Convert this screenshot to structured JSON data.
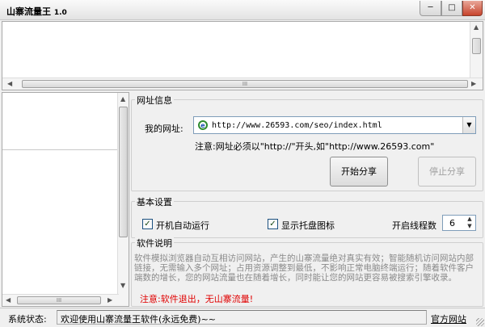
{
  "window": {
    "title": "山寨流量王",
    "version": "1.0",
    "minimize_glyph": "─",
    "maximize_glyph": "□",
    "close_glyph": "✕"
  },
  "browser": {
    "hscroll_grip": "III"
  },
  "left_pane": {
    "hscroll_grip": "III"
  },
  "url_group": {
    "title": "网址信息",
    "label": "我的网址:",
    "url_value": "http://www.26593.com/seo/index.html",
    "note": "注意:网址必须以\"http://\"开头,如\"http://www.26593.com\"",
    "start_button": "开始分享",
    "stop_button": "停止分享"
  },
  "settings_group": {
    "title": "基本设置",
    "autorun_label": "开机自动运行",
    "autorun_checked": true,
    "tray_label": "显示托盘图标",
    "tray_checked": true,
    "threads_label": "开启线程数",
    "threads_value": "6"
  },
  "about_group": {
    "title": "软件说明",
    "description": "软件模拟浏览器自动互相访问网站，产生的山寨流量绝对真实有效；智能随机访问网站内部链接，无需输入多个网址；占用资源调整到最低，不影响正常电脑终端运行；随着软件客户端数的增长，您的网站流量也在随着增长，同时能让您的网站更容易被搜索引擎收录。",
    "warning": "注意:软件退出，无山寨流量!"
  },
  "statusbar": {
    "label": "系统状态:",
    "text": "欢迎使用山寨流量王软件(永远免费)~~",
    "official_link": "官方网站"
  }
}
